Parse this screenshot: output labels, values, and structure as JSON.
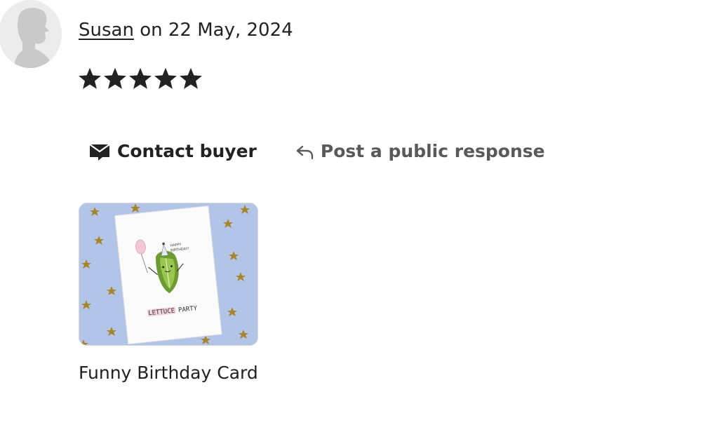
{
  "review": {
    "author": "Susan",
    "date_text": " on 22 May, 2024",
    "rating": 5,
    "rating_max": 5
  },
  "actions": {
    "contact_label": "Contact buyer",
    "contact_icon": "envelope-icon",
    "public_response_label": "Post a public response",
    "public_response_icon": "reply-arrow-icon"
  },
  "listing": {
    "title": "Funny Birthday Card",
    "card_text_top": "HAPPY BIRTHDAY!",
    "card_text_bottom_1": "LETTUCE",
    "card_text_bottom_2": "PARTY"
  },
  "colors": {
    "text_primary": "#222222",
    "text_secondary": "#595959",
    "image_background": "#b2c4e8",
    "star_color": "#222222"
  }
}
